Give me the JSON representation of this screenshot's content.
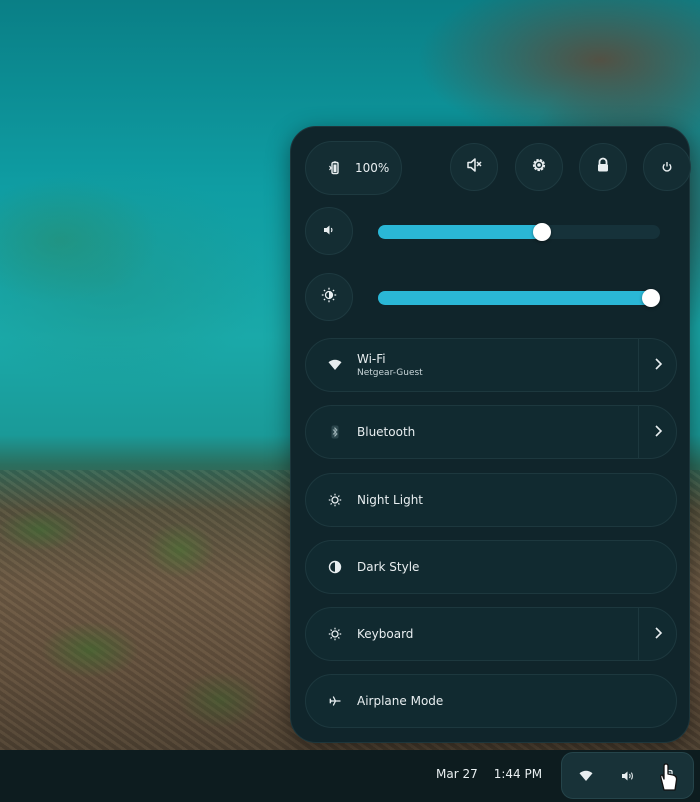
{
  "top_bar": {
    "battery_label": "100%",
    "buttons": [
      {
        "name": "screen-reader",
        "icon": "mute-speaker-icon"
      },
      {
        "name": "settings",
        "icon": "gear-icon"
      },
      {
        "name": "lock",
        "icon": "lock-icon"
      },
      {
        "name": "power",
        "icon": "power-icon"
      }
    ]
  },
  "sliders": {
    "volume": {
      "icon": "speaker-icon",
      "level": 0.58
    },
    "brightness": {
      "icon": "brightness-icon",
      "level": 0.97
    }
  },
  "toggles": {
    "wifi": {
      "title": "Wi-Fi",
      "subtitle": "Netgear-Guest",
      "icon": "wifi-icon"
    },
    "bluetooth": {
      "title": "Bluetooth",
      "icon": "bluetooth-icon"
    },
    "night_light": {
      "title": "Night Light",
      "icon": "night-light-icon"
    },
    "dark_style": {
      "title": "Dark Style",
      "icon": "dark-style-icon"
    },
    "keyboard": {
      "title": "Keyboard",
      "icon": "keyboard-icon"
    },
    "airplane": {
      "title": "Airplane Mode",
      "icon": "airplane-icon"
    }
  },
  "taskbar": {
    "date": "Mar 27",
    "time": "1:44 PM"
  },
  "colors": {
    "panel_bg": "#10252b",
    "accent": "#2ab7d6",
    "text": "#e8eef0"
  }
}
